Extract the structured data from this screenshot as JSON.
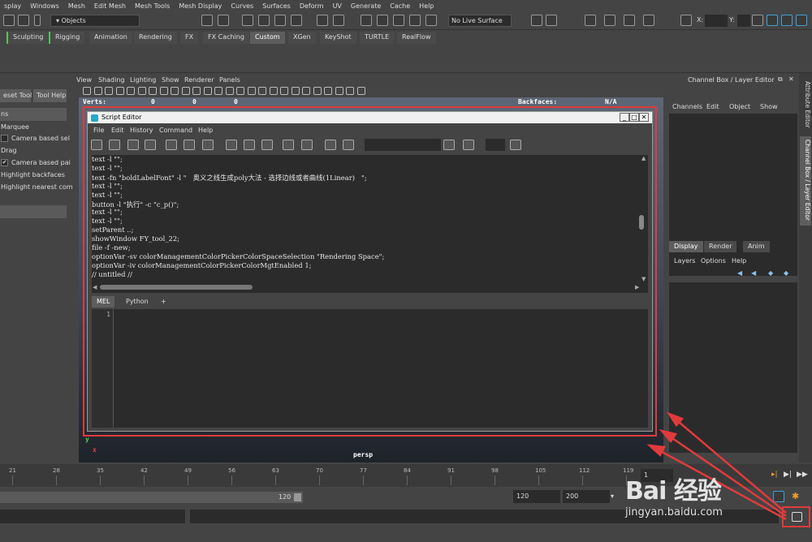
{
  "menubar": [
    "splay",
    "Windows",
    "Mesh",
    "Edit Mesh",
    "Mesh Tools",
    "Mesh Display",
    "Curves",
    "Surfaces",
    "Deform",
    "UV",
    "Generate",
    "Cache",
    "Help"
  ],
  "statusline": {
    "objects_dropdown": "Objects",
    "live_surface": "No Live Surface",
    "x_label": "X:",
    "y_label": "Y:"
  },
  "shelf_tabs": [
    "Sculpting",
    "Rigging",
    "Animation",
    "Rendering",
    "FX",
    "FX Caching",
    "Custom",
    "XGen",
    "KeyShot",
    "TURTLE",
    "RealFlow"
  ],
  "shelf_active": "Custom",
  "tool_settings": {
    "reset_tool": "eset Tool",
    "tool_help": "Tool Help",
    "section_header": "ns",
    "marquee": "Marquee",
    "camera_based_sel": "Camera based sel",
    "drag": "Drag",
    "camera_based_pai": "Camera based pai",
    "highlight_backfaces": "Highlight backfaces",
    "highlight_nearest": "Highlight nearest com"
  },
  "viewport": {
    "menu": [
      "View",
      "Shading",
      "Lighting",
      "Show",
      "Renderer",
      "Panels"
    ],
    "hud_verts_label": "Verts:",
    "hud_verts_values": [
      "0",
      "0",
      "0"
    ],
    "hud_backfaces_label": "Backfaces:",
    "hud_backfaces_value": "N/A",
    "camera_name": "persp",
    "axis_y": "y",
    "axis_x": "x"
  },
  "script_editor": {
    "title": "Script Editor",
    "menu": [
      "File",
      "Edit",
      "History",
      "Command",
      "Help"
    ],
    "history_lines": [
      "text -l \"\";",
      "text -l \"\";",
      "text -fn \"boldLabelFont\" -l \"   奥义之线生成poly大法 - 选择边线或者曲线(1Linear)   \";",
      "text -l \"\";",
      "text -l \"\";",
      "button -l \"执行\" -c \"c_p()\";",
      "text -l \"\";",
      "text -l \"\";",
      "setParent ..;",
      "showWindow FY_tool_22;",
      "file -f -new;",
      "optionVar -sv colorManagementColorPickerColorSpaceSelection \"Rendering Space\";",
      "optionVar -iv colorManagementColorPickerColorMgtEnabled 1;",
      "// untitled //"
    ],
    "tabs": [
      "MEL",
      "Python",
      "+"
    ],
    "active_tab": "MEL",
    "line_number": "1"
  },
  "channel_box": {
    "header": "Channel Box / Layer Editor",
    "menu": [
      "Channels",
      "Edit",
      "Object",
      "Show"
    ],
    "tabs": [
      "Display",
      "Render",
      "Anim"
    ],
    "active_tab": "Display",
    "layer_menu": [
      "Layers",
      "Options",
      "Help"
    ]
  },
  "side_tabs": [
    "Attribute Editor",
    "Channel Box / Layer Editor"
  ],
  "timeline": {
    "ticks": [
      "21",
      "28",
      "35",
      "42",
      "49",
      "56",
      "63",
      "70",
      "77",
      "84",
      "91",
      "98",
      "105",
      "112",
      "119"
    ],
    "current_frame": "1"
  },
  "range": {
    "range_end": "120",
    "playback_end": "120",
    "anim_end": "200"
  },
  "watermark": {
    "logo": "Bai 经验",
    "url": "jingyan.baidu.com"
  },
  "colors": {
    "annotation_red": "#e03b3b",
    "panel_bg": "#444444",
    "field_bg": "#2b2b2b",
    "active_tab": "#5d5d5d",
    "shelf_green": "#56c25b"
  }
}
